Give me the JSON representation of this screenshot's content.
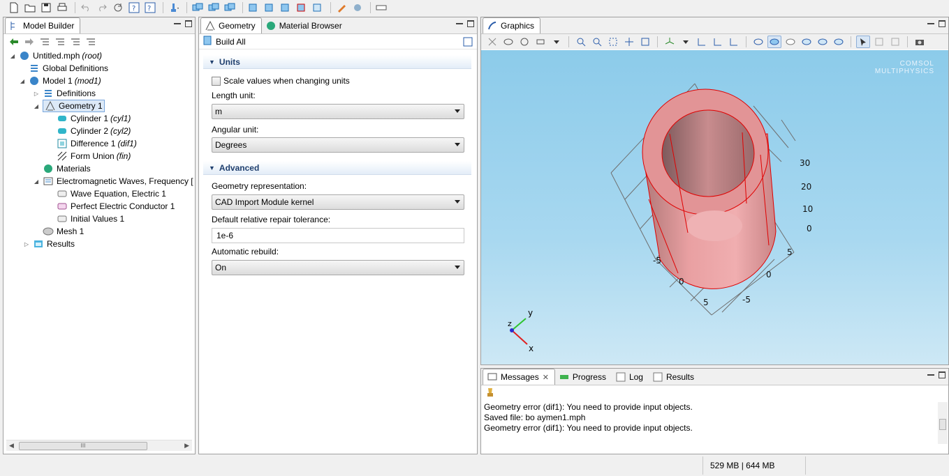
{
  "model_builder": {
    "title": "Model Builder",
    "tree": [
      {
        "label": "Untitled.mph",
        "tag": "(root)"
      },
      {
        "label": "Global Definitions",
        "tag": ""
      },
      {
        "label": "Model 1",
        "tag": "(mod1)"
      },
      {
        "label": "Definitions",
        "tag": ""
      },
      {
        "label": "Geometry 1",
        "tag": ""
      },
      {
        "label": "Cylinder 1",
        "tag": "(cyl1)"
      },
      {
        "label": "Cylinder 2",
        "tag": "(cyl2)"
      },
      {
        "label": "Difference 1",
        "tag": "(dif1)"
      },
      {
        "label": "Form Union",
        "tag": "(fin)"
      },
      {
        "label": "Materials",
        "tag": ""
      },
      {
        "label": "Electromagnetic Waves, Frequency [",
        "tag": ""
      },
      {
        "label": "Wave Equation, Electric 1",
        "tag": ""
      },
      {
        "label": "Perfect Electric Conductor 1",
        "tag": ""
      },
      {
        "label": "Initial Values 1",
        "tag": ""
      },
      {
        "label": "Mesh 1",
        "tag": ""
      },
      {
        "label": "Results",
        "tag": ""
      }
    ],
    "scroll_thumb": "III"
  },
  "settings": {
    "tabs": {
      "geometry": "Geometry",
      "material_browser": "Material Browser"
    },
    "build_all": "Build All",
    "units": {
      "title": "Units",
      "scale_checkbox": "Scale values when changing units",
      "length_label": "Length unit:",
      "length_value": "m",
      "angular_label": "Angular unit:",
      "angular_value": "Degrees"
    },
    "advanced": {
      "title": "Advanced",
      "geom_rep_label": "Geometry representation:",
      "geom_rep_value": "CAD Import Module kernel",
      "tolerance_label": "Default relative repair tolerance:",
      "tolerance_value": "1e-6",
      "rebuild_label": "Automatic rebuild:",
      "rebuild_value": "On"
    }
  },
  "graphics": {
    "title": "Graphics",
    "logo_line1": "COMSOL",
    "logo_line2": "MULTIPHYSICS",
    "z_ticks": [
      "30",
      "20",
      "10",
      "0"
    ],
    "y_ticks": [
      "-5",
      "0",
      "5"
    ],
    "x_ticks": [
      "5",
      "0",
      "-5"
    ],
    "axis_labels": {
      "x": "x",
      "y": "y",
      "z": "z"
    },
    "colors": {
      "cylinder": "#e8999a",
      "edge": "#e00000",
      "background_top": "#8ccbea"
    }
  },
  "messages": {
    "tabs": {
      "messages": "Messages",
      "progress": "Progress",
      "log": "Log",
      "results": "Results"
    },
    "lines": [
      "Geometry error (dif1): You need to provide input objects.",
      "Saved file: bo aymen1.mph",
      "Geometry error (dif1): You need to provide input objects."
    ]
  },
  "status": {
    "memory": "529 MB | 644 MB"
  }
}
